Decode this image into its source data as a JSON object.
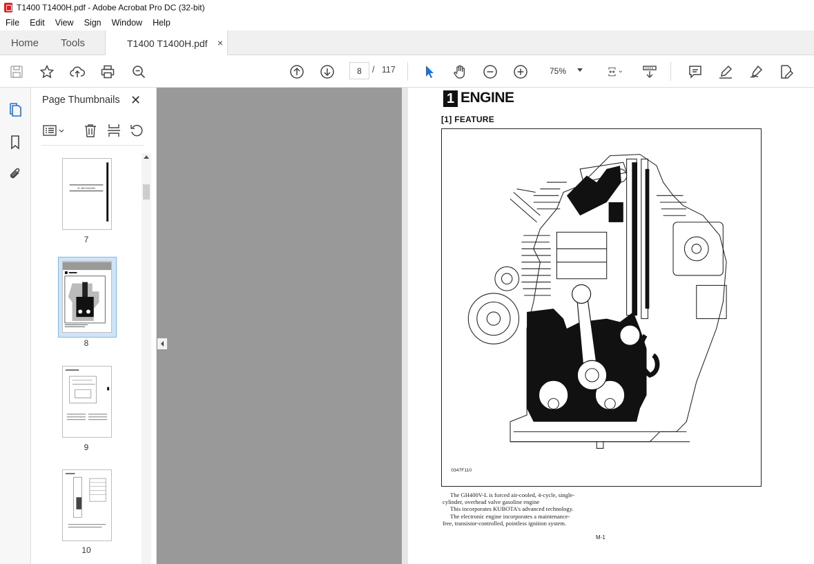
{
  "window": {
    "title": "T1400 T1400H.pdf - Adobe Acrobat Pro DC (32-bit)"
  },
  "menu": [
    "File",
    "Edit",
    "View",
    "Sign",
    "Window",
    "Help"
  ],
  "tabs": {
    "home": "Home",
    "tools": "Tools",
    "document": "T1400 T1400H.pdf",
    "close": "×"
  },
  "toolbar": {
    "current_page": "8",
    "page_separator": "/",
    "total_pages": "117",
    "zoom": "75%"
  },
  "panel": {
    "title": "Page Thumbnails",
    "close": "✕"
  },
  "thumbnails": [
    {
      "label": "7",
      "caption": "M. MECHANISM"
    },
    {
      "label": "8"
    },
    {
      "label": "9"
    },
    {
      "label": "10"
    }
  ],
  "page": {
    "chapter_number": "1",
    "chapter_title": "ENGINE",
    "section": "[1]  FEATURE",
    "figure_code": "0347F110",
    "body_lines": [
      "The GH400V-L is forced air-cooled, 4-cycle, single-",
      "cylinder, overhead valve gasoline engine",
      "This incorporates KUBOTA's advanced technology.",
      "The electronic engine incorporates a maintenance-",
      "free, transistor-controlled, pointless ignition system."
    ],
    "page_number": "M-1"
  },
  "colors": {
    "accent_blue": "#1473e6",
    "selection": "#cfe4f7",
    "gray_canvas": "#999999"
  }
}
